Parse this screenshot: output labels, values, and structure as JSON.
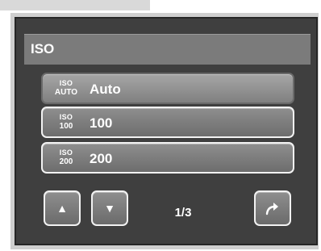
{
  "menu": {
    "title": "ISO",
    "options": [
      {
        "icon_top": "ISO",
        "icon_bottom": "AUTO",
        "label": "Auto",
        "selected": true
      },
      {
        "icon_top": "ISO",
        "icon_bottom": "100",
        "label": "100",
        "selected": false
      },
      {
        "icon_top": "ISO",
        "icon_bottom": "200",
        "label": "200",
        "selected": false
      }
    ]
  },
  "navigation": {
    "up_icon": "triangle-up-icon",
    "down_icon": "triangle-down-icon",
    "enter_icon": "curved-arrow-icon",
    "page": "1/3"
  },
  "colors": {
    "title_bar": "#7b7b7b",
    "button": "#7f7f7f",
    "screen": "#3f3f3f",
    "text": "#ffffff"
  }
}
